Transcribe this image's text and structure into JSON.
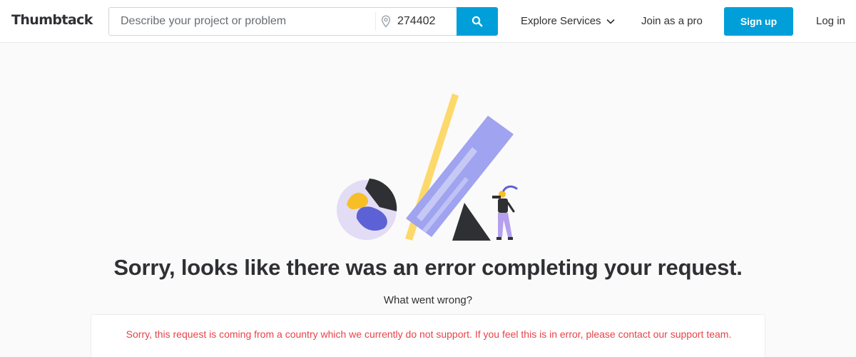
{
  "header": {
    "logo_text": "Thumbtack",
    "search_placeholder": "Describe your project or problem",
    "zip_value": "274402",
    "explore_label": "Explore Services",
    "join_label": "Join as a pro",
    "signup_label": "Sign up",
    "login_label": "Log in",
    "icons": [
      "location-pin-icon",
      "search-icon",
      "chevron-down-icon"
    ]
  },
  "main": {
    "headline": "Sorry, looks like there was an error completing your request.",
    "subhead": "What went wrong?",
    "error_message": "Sorry, this request is coming from a country which we currently do not support. If you feel this is in error, please contact our support team."
  },
  "colors": {
    "brand_blue": "#009fd9",
    "error_red": "#e8434a",
    "text_dark": "#2f3033",
    "background": "#fafafa",
    "illustration_purple": "#9fa3f0",
    "illustration_yellow": "#fdd96b",
    "illustration_lavender": "#e3dcf5"
  }
}
